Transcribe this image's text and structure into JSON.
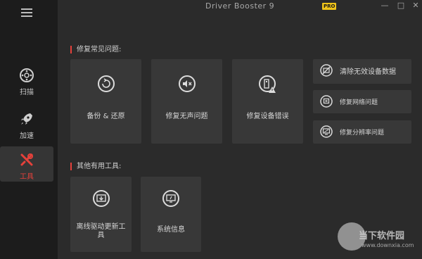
{
  "app": {
    "title": "Driver Booster 9",
    "badge": "PRO"
  },
  "window_controls": {
    "minimize": "—",
    "maximize": "□",
    "close": "✕"
  },
  "sidebar": {
    "items": [
      {
        "label": "扫描",
        "icon": "scan-icon"
      },
      {
        "label": "加速",
        "icon": "rocket-icon"
      },
      {
        "label": "工具",
        "icon": "tools-icon",
        "active": true
      }
    ]
  },
  "sections": {
    "fix_common": "修复常见问题:",
    "other_tools": "其他有用工具:"
  },
  "fix_cards": [
    {
      "label": "备份 & 还原",
      "icon": "backup-restore-icon"
    },
    {
      "label": "修复无声问题",
      "icon": "no-sound-icon"
    },
    {
      "label": "修复设备错误",
      "icon": "device-error-icon"
    }
  ],
  "fix_small": [
    {
      "label": "清除无效设备数据",
      "icon": "clean-device-icon"
    },
    {
      "label": "修复网络问题",
      "icon": "network-icon"
    },
    {
      "label": "修复分辨率问题",
      "icon": "resolution-icon"
    }
  ],
  "tool_cards": [
    {
      "label": "离线驱动更新工具",
      "icon": "offline-update-icon"
    },
    {
      "label": "系统信息",
      "icon": "system-info-icon"
    }
  ],
  "watermark": {
    "text": "当下软件园",
    "url": "www.downxia.com"
  },
  "colors": {
    "accent": "#e5413b",
    "card": "#383838",
    "bg": "#2b2b2b",
    "sidebar": "#1c1c1c"
  }
}
